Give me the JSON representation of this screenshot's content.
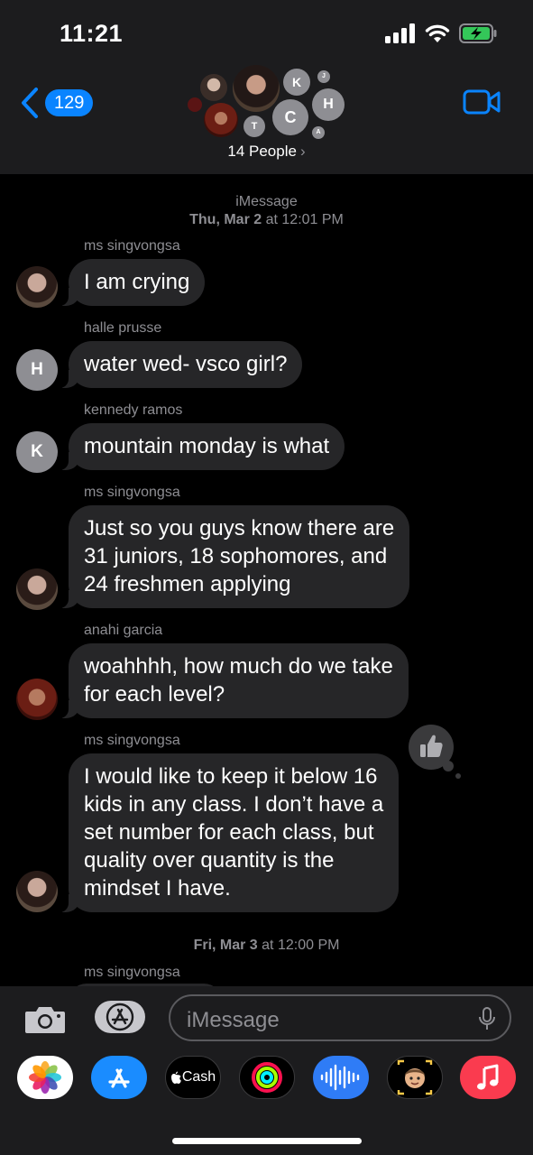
{
  "status": {
    "time": "11:21"
  },
  "header": {
    "back_count": "129",
    "group_title": "14 People",
    "chevron": "›",
    "avatars": [
      {
        "initial": "K"
      },
      {
        "initial": "H"
      },
      {
        "initial": "C"
      },
      {
        "initial": "T"
      },
      {
        "initial": "J"
      },
      {
        "initial": "A"
      }
    ]
  },
  "conversation": {
    "service": "iMessage",
    "first_timestamp_day": "Thu, Mar 2",
    "first_timestamp_sep": "at",
    "first_timestamp_time": "12:01 PM",
    "messages": [
      {
        "sender": "ms singvongsa",
        "avatar": "photo",
        "lines": [
          "I am crying"
        ]
      },
      {
        "sender": "halle prusse",
        "avatar": "H",
        "lines": [
          "water wed- vsco girl?"
        ]
      },
      {
        "sender": "kennedy ramos",
        "avatar": "K",
        "lines": [
          "mountain monday is what"
        ]
      },
      {
        "sender": "ms singvongsa",
        "avatar": "photo",
        "lines": [
          "Just so you guys know there are",
          "31 juniors, 18 sophomores, and",
          "24 freshmen applying"
        ]
      },
      {
        "sender": "anahi garcia",
        "avatar": "photo",
        "lines": [
          "woahhhh, how much do we take",
          "for each level?"
        ]
      },
      {
        "sender": "ms singvongsa",
        "avatar": "photo",
        "tapback": "thumbs-up",
        "lines": [
          "I would like to keep it below 16",
          "kids in any class. I don’t have a",
          "set number for each class, but",
          "quality over quantity is the",
          "mindset I have."
        ]
      }
    ],
    "second_timestamp_day": "Fri, Mar 3",
    "second_timestamp_sep": "at",
    "second_timestamp_time": "12:00 PM",
    "last_sender": "ms singvongsa"
  },
  "input": {
    "placeholder": "iMessage"
  },
  "drawer": {
    "apps": [
      "photos-app-icon",
      "app-store-icon",
      "apple-cash-icon",
      "activity-icon",
      "audio-message-icon",
      "memoji-icon",
      "music-icon"
    ],
    "cash_label": "Cash"
  },
  "colors": {
    "header_bg": "#1c1c1e",
    "bubble_bg": "#262628",
    "accent_blue": "#0a84ff",
    "meta_gray": "#8e8e93",
    "battery_green": "#34c759",
    "music_red": "#fa3b4f"
  }
}
